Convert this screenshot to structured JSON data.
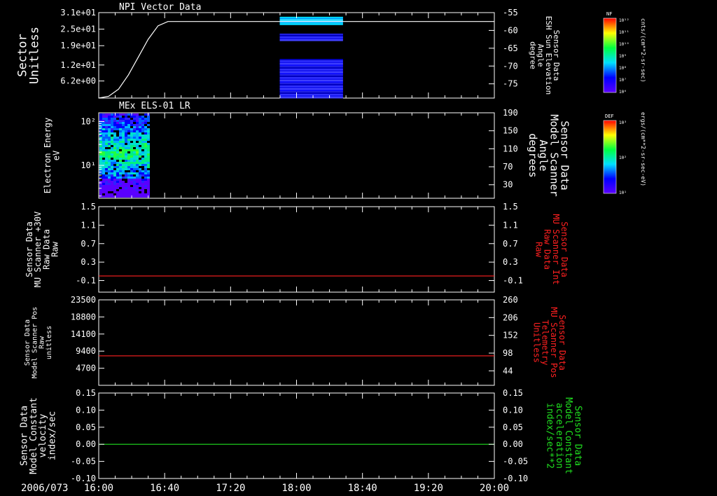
{
  "date_label": "2006/073",
  "colors": {
    "white": "#ffffff",
    "red": "#ff2020",
    "green": "#20e020",
    "frame": "#ffffff"
  },
  "time_axis": {
    "ticks": [
      "16:00",
      "16:40",
      "17:20",
      "18:00",
      "18:40",
      "19:20",
      "20:00"
    ],
    "range_hours": [
      16,
      20
    ]
  },
  "colorbars": [
    {
      "title": "NF",
      "units": "cnts/(cm**2-sr-sec)",
      "tick_labels": [
        "10¹²",
        "10¹¹",
        "10¹⁰",
        "10⁹",
        "10⁸",
        "10⁷",
        "10⁶"
      ]
    },
    {
      "title": "DEF",
      "units": "ergs/(cm**2-sr-sec-eV)",
      "tick_labels": [
        "10³",
        "10²",
        "10¹"
      ]
    }
  ],
  "chart_data": [
    {
      "type": "heatmap",
      "title": "NPI Vector Data",
      "ylabel_left": [
        "Sector",
        "Unitless"
      ],
      "left_ticks": [
        "3.1e+01",
        "2.5e+01",
        "1.9e+01",
        "1.2e+01",
        "6.2e+00"
      ],
      "ylim_left": [
        0,
        31
      ],
      "ylabel_right": [
        "Sensor Data",
        "ESH Sun Elevation",
        "Angle",
        "degree"
      ],
      "right_ticks": [
        "-55",
        "-60",
        "-65",
        "-70",
        "-75"
      ],
      "ylim_right": [
        -79,
        -55
      ],
      "line_series": {
        "name": "Sun Elevation",
        "color": "#ffffff",
        "x": [
          16.0,
          16.1,
          16.2,
          16.3,
          16.4,
          16.5,
          16.6,
          16.7,
          16.8,
          20.0
        ],
        "y": [
          -79.0,
          -78.5,
          -76.5,
          -72.5,
          -67.5,
          -62.5,
          -58.7,
          -57.5,
          -57.5,
          -57.5
        ]
      },
      "heat_blocks": [
        {
          "x": [
            17.83,
            18.47
          ],
          "y": [
            29.5,
            26.6
          ],
          "level": "cyan"
        },
        {
          "x": [
            17.83,
            18.47
          ],
          "y": [
            23.4,
            20.8
          ],
          "level": "blue"
        },
        {
          "x": [
            17.83,
            18.47
          ],
          "y": [
            14.2,
            0.0
          ],
          "level": "blue"
        }
      ]
    },
    {
      "type": "heatmap",
      "title": "MEx ELS-01 LR",
      "ylabel_left": [
        "Electron Energy",
        "eV"
      ],
      "left_ticks": [
        "10²",
        "10¹"
      ],
      "ylim_left_log": [
        0.25,
        2.2
      ],
      "ylabel_right": [
        "Sensor Data",
        "Model Scanner",
        "Angle",
        "degrees"
      ],
      "right_ticks": [
        "190",
        "150",
        "110",
        "70",
        "30"
      ],
      "ylim_right": [
        0,
        190
      ],
      "x_extent_hours": [
        16.0,
        16.5
      ]
    },
    {
      "type": "line",
      "ylabel_left": [
        "Sensor Data",
        "MU Scanner +30V",
        "Raw Data",
        "Raw"
      ],
      "left_ticks": [
        "1.5",
        "1.1",
        "0.7",
        "0.3",
        "-0.1"
      ],
      "ylim_left": [
        -0.35,
        1.5
      ],
      "ylabel_right": [
        "Sensor Data",
        "MU Scanner Int",
        "Raw Data",
        "Raw"
      ],
      "right_ticks": [
        "1.5",
        "1.1",
        "0.7",
        "0.3",
        "-0.1"
      ],
      "ylim_right": [
        -0.35,
        1.5
      ],
      "series": [
        {
          "color": "#ff2020",
          "x": [
            16.0,
            20.0
          ],
          "y": [
            0.0,
            0.0
          ]
        }
      ]
    },
    {
      "type": "line",
      "ylabel_left": [
        "Sensor Data",
        "Model Scanner Pos",
        "Raw",
        "unitless"
      ],
      "left_ticks": [
        "23500",
        "18800",
        "14100",
        "9400",
        "4700"
      ],
      "ylim_left": [
        0,
        23500
      ],
      "ylabel_right": [
        "Sensor Data",
        "MU Scanner Pos",
        "Telemetry",
        "Unitless"
      ],
      "right_ticks": [
        "260",
        "206",
        "152",
        "98",
        "44"
      ],
      "ylim_right": [
        0,
        260
      ],
      "series": [
        {
          "color": "#ff2020",
          "x": [
            16.0,
            20.0
          ],
          "y": [
            8100,
            8100
          ]
        }
      ]
    },
    {
      "type": "line",
      "ylabel_left": [
        "Sensor Data",
        "Model Constant",
        "velocity",
        "index/sec"
      ],
      "left_ticks": [
        "0.15",
        "0.10",
        "0.05",
        "0.00",
        "-0.05",
        "-0.10"
      ],
      "ylim_left": [
        -0.1,
        0.15
      ],
      "ylabel_right": [
        "Sensor Data",
        "Model Constant",
        "acceleration",
        "index/sec**2"
      ],
      "right_ticks": [
        "0.15",
        "0.10",
        "0.05",
        "0.00",
        "-0.05",
        "-0.10"
      ],
      "ylim_right": [
        -0.1,
        0.15
      ],
      "series": [
        {
          "color": "#20e020",
          "x": [
            16.0,
            20.0
          ],
          "y": [
            0.0,
            0.0
          ]
        }
      ]
    }
  ]
}
